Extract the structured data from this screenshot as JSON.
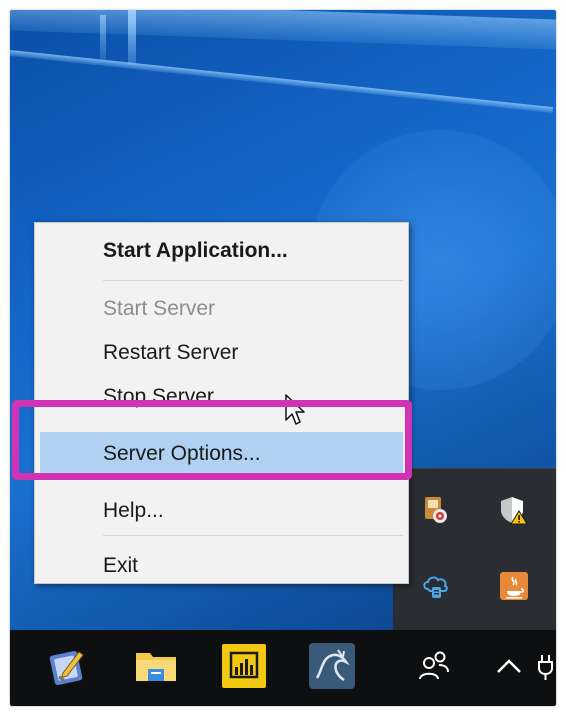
{
  "context_menu": {
    "items": [
      {
        "label": "Start Application...",
        "style": "bold"
      },
      {
        "label": "Start Server",
        "state": "disabled"
      },
      {
        "label": "Restart Server"
      },
      {
        "label": "Stop Server"
      },
      {
        "label": "Server Options...",
        "state": "hovered"
      },
      {
        "label": "Help..."
      },
      {
        "label": "Exit"
      }
    ]
  },
  "annotation": {
    "color": "#d232b4",
    "target": "Server Options..."
  },
  "colors": {
    "desktop": "#1466c7",
    "menu_background": "#f2f2f2",
    "menu_hover": "#b0d1f2",
    "taskbar": "#0e0f11",
    "tray_flyout": "#2a2d31"
  },
  "tray_flyout_icons": [
    "media-player-icon",
    "security-shield-warning-icon",
    "cloud-sync-icon",
    "java-icon"
  ],
  "taskbar_icons": [
    "notes-app-icon",
    "file-explorer-icon",
    "power-bi-icon",
    "mysql-workbench-icon",
    "people-icon",
    "chevron-up-icon",
    "power-plug-icon"
  ]
}
